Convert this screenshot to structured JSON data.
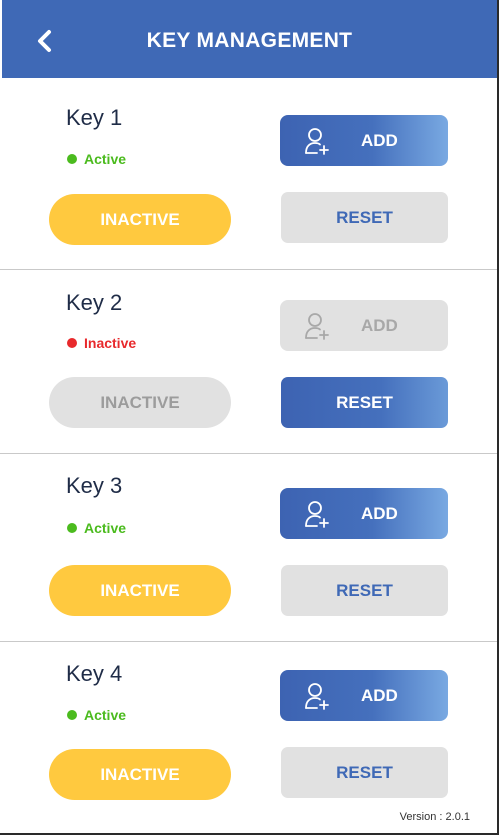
{
  "header": {
    "title": "KEY MANAGEMENT",
    "back_icon": "chevron-left-icon"
  },
  "colors": {
    "header": "#3f69b6",
    "active_status": "#4bbb1e",
    "inactive_status": "#e8292c",
    "inactive_button": "#ffc93f",
    "disabled": "#e1e1e1"
  },
  "keys": [
    {
      "name": "Key 1",
      "status": "Active",
      "add_label": "ADD",
      "add_icon": "add-user-icon",
      "inactive_label": "INACTIVE",
      "reset_label": "RESET"
    },
    {
      "name": "Key 2",
      "status": "Inactive",
      "add_label": "ADD",
      "add_icon": "add-user-icon",
      "inactive_label": "INACTIVE",
      "reset_label": "RESET"
    },
    {
      "name": "Key 3",
      "status": "Active",
      "add_label": "ADD",
      "add_icon": "add-user-icon",
      "inactive_label": "INACTIVE",
      "reset_label": "RESET"
    },
    {
      "name": "Key 4",
      "status": "Active",
      "add_label": "ADD",
      "add_icon": "add-user-icon",
      "inactive_label": "INACTIVE",
      "reset_label": "RESET"
    }
  ],
  "footer": {
    "version": "Version : 2.0.1"
  }
}
